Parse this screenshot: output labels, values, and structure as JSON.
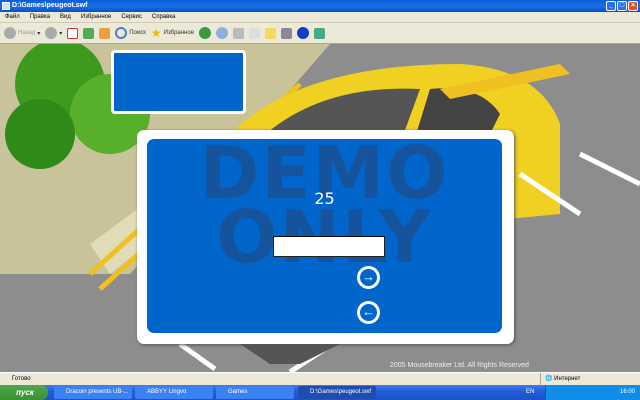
{
  "window": {
    "title": "D:\\Games\\peugeot.swf"
  },
  "menu": [
    "Файл",
    "Правка",
    "Вид",
    "Избранное",
    "Сервис",
    "Справка"
  ],
  "toolbar": {
    "back": "Назад",
    "search": "Поиск",
    "favorites": "Избранное"
  },
  "game": {
    "watermark_line1": "DEMO",
    "watermark_line2": "ONLY",
    "score": "25",
    "name_value": "",
    "copyright": "2005 Mousebreaker Ltd. All Rights Reserved"
  },
  "status": {
    "text": "Готово",
    "zone": "Интернет"
  },
  "taskbar": {
    "start": "пуск",
    "tasks": [
      "Dracoin presents UB-...",
      "ABBYY Lingvo",
      "Games",
      "D:\\Games\\peugeot.swf"
    ],
    "lang": "EN",
    "clock": "16:00"
  },
  "colors": {
    "game_blue": "#0066cc",
    "watermark": "#1c4f8c"
  }
}
